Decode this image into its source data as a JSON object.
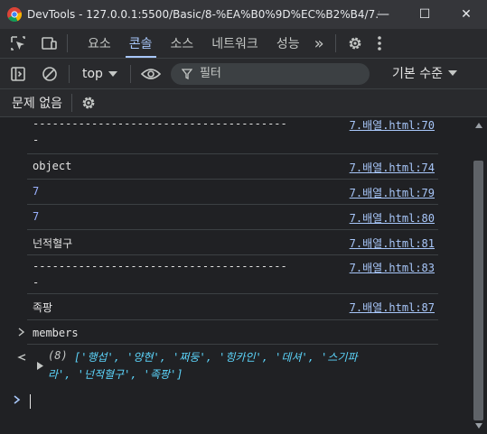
{
  "window": {
    "title": "DevTools - 127.0.0.1:5500/Basic/8-%EA%B0%9D%EC%B2%B4/7.%E...",
    "minimize_glyph": "—",
    "maximize_glyph": "☐",
    "close_glyph": "✕"
  },
  "tabs": {
    "elements_icon": "inspect-icon",
    "device_icon": "device-toolbar-icon",
    "items": [
      "요소",
      "콘솔",
      "소스",
      "네트워크",
      "성능"
    ],
    "active": "콘솔",
    "more": "»"
  },
  "toolbar": {
    "context": "top",
    "filter_placeholder": "필터",
    "level": "기본 수준"
  },
  "issues": {
    "label": "문제 없음"
  },
  "console": {
    "messages": [
      {
        "line1": "---------------------------------------",
        "line2": "-",
        "source": "7.배열.html:70",
        "kind": "text"
      },
      {
        "line1": "object",
        "line2": "",
        "source": "7.배열.html:74",
        "kind": "text"
      },
      {
        "line1": "7",
        "line2": "",
        "source": "7.배열.html:79",
        "kind": "number"
      },
      {
        "line1": "7",
        "line2": "",
        "source": "7.배열.html:80",
        "kind": "number"
      },
      {
        "line1": "넌적혈구",
        "line2": "",
        "source": "7.배열.html:81",
        "kind": "text"
      },
      {
        "line1": "---------------------------------------",
        "line2": "-",
        "source": "7.배열.html:83",
        "kind": "text"
      },
      {
        "line1": "족팡",
        "line2": "",
        "source": "7.배열.html:87",
        "kind": "text"
      }
    ],
    "input_echo": "members",
    "result_count": "(8)",
    "result_items": [
      "'행섭'",
      "'양현'",
      "'쩌둥'",
      "'힝카인'",
      "'데셔'",
      "'스기파라'",
      "'넌적혈구'",
      "'족팡'"
    ],
    "result_line1": "['행섭', '양현', '쩌둥', '힝카인', '데셔', '스기파",
    "result_line2": "라', '넌적혈구', '족팡']"
  },
  "colors": {
    "accent": "#a8c7fa",
    "background": "#202124",
    "number": "#9ab1ff",
    "string": "#5cd5fb"
  }
}
